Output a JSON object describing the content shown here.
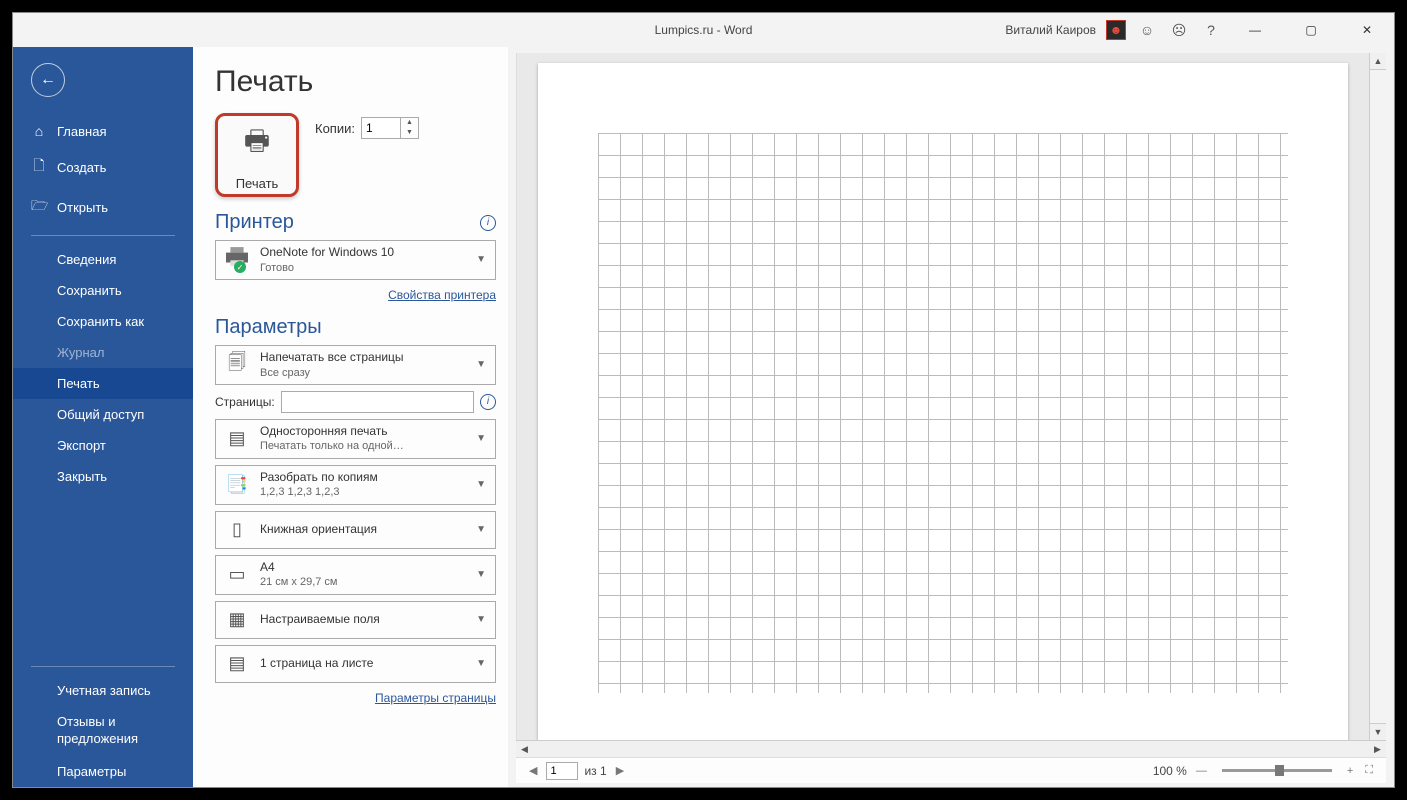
{
  "title": "Lumpics.ru  -  Word",
  "user": "Виталий Каиров",
  "sidebar": {
    "home": "Главная",
    "new": "Создать",
    "open": "Открыть",
    "info": "Сведения",
    "save": "Сохранить",
    "saveas": "Сохранить как",
    "history": "Журнал",
    "print": "Печать",
    "share": "Общий доступ",
    "export": "Экспорт",
    "close": "Закрыть",
    "account": "Учетная запись",
    "feedback1": "Отзывы и",
    "feedback2": "предложения",
    "options": "Параметры"
  },
  "print": {
    "pageTitle": "Печать",
    "buttonLabel": "Печать",
    "copiesLabel": "Копии:",
    "copiesValue": "1",
    "printerHead": "Принтер",
    "printerName": "OneNote for Windows 10",
    "printerStatus": "Готово",
    "printerProps": "Свойства принтера",
    "settingsHead": "Параметры",
    "allPagesTitle": "Напечатать все страницы",
    "allPagesSub": "Все сразу",
    "pagesLabel": "Страницы:",
    "oneSideTitle": "Односторонняя печать",
    "oneSideSub": "Печатать только на одной…",
    "collateTitle": "Разобрать по копиям",
    "collateSub": "1,2,3    1,2,3    1,2,3",
    "orientTitle": "Книжная ориентация",
    "paperTitle": "A4",
    "paperSub": "21 см x 29,7 см",
    "marginsTitle": "Настраиваемые поля",
    "sheetsTitle": "1 страница на листе",
    "pageSetup": "Параметры страницы"
  },
  "status": {
    "pageInput": "1",
    "pageOf": "из 1",
    "zoom": "100 %"
  }
}
